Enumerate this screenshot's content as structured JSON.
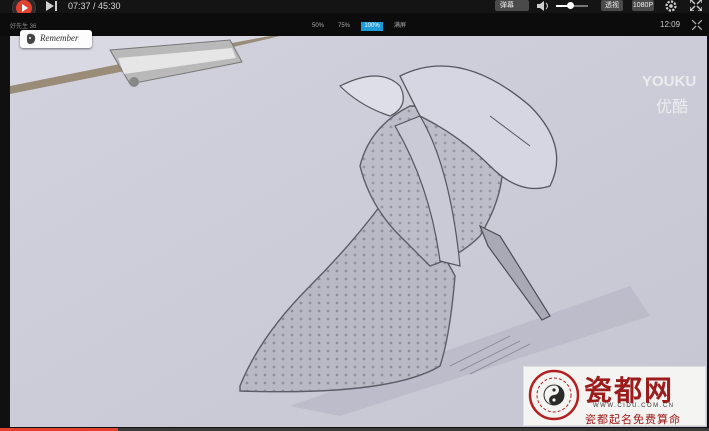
{
  "player": {
    "time_display": "07:37 / 45:30",
    "progress_fraction": 0.167,
    "danmu_label": "弹幕",
    "volume_fraction": 0.45,
    "resolution_label": "1080P",
    "tone_label": "透视",
    "uploader": "好先生 36",
    "ratios": [
      "50%",
      "75%",
      "100%",
      "满屏"
    ],
    "active_ratio": "100%",
    "clock": "12:09",
    "accent_color": "#e2412f"
  },
  "overlay": {
    "remember_label": "Remember",
    "youku_latin": "YOUKU",
    "youku_cn": "优酷"
  },
  "watermark": {
    "big_text": "瓷都网",
    "url": "WWW.CIDU.COM.CN",
    "slogan": "瓷都起名免费算命"
  }
}
